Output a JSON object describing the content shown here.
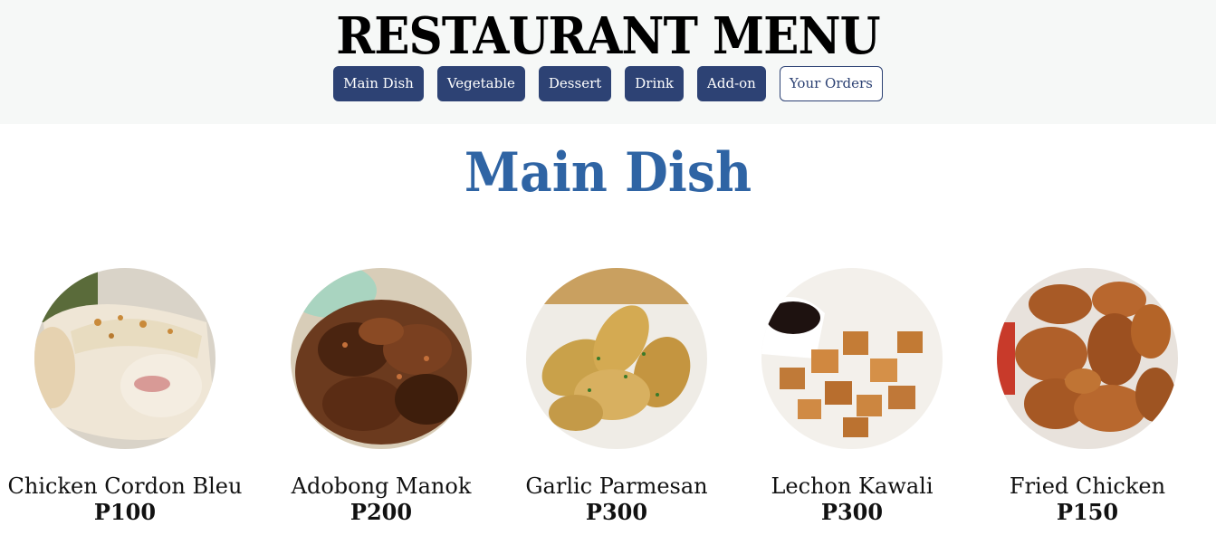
{
  "header": {
    "title": "RESTAURANT MENU",
    "nav": [
      {
        "label": "Main Dish"
      },
      {
        "label": "Vegetable"
      },
      {
        "label": "Dessert"
      },
      {
        "label": "Drink"
      },
      {
        "label": "Add-on"
      },
      {
        "label": "Your Orders"
      }
    ]
  },
  "section": {
    "title": "Main Dish"
  },
  "items": [
    {
      "name": "Chicken Cordon Bleu",
      "price": "P100",
      "image": "chicken-cordon-bleu"
    },
    {
      "name": "Adobong Manok",
      "price": "P200",
      "image": "adobong-manok"
    },
    {
      "name": "Garlic Parmesan",
      "price": "P300",
      "image": "garlic-parmesan"
    },
    {
      "name": "Lechon Kawali",
      "price": "P300",
      "image": "lechon-kawali"
    },
    {
      "name": "Fried Chicken",
      "price": "P150",
      "image": "fried-chicken"
    }
  ],
  "colors": {
    "header_bg": "#f6f8f7",
    "button_bg": "#2d4274",
    "section_title": "#2f64a4"
  }
}
